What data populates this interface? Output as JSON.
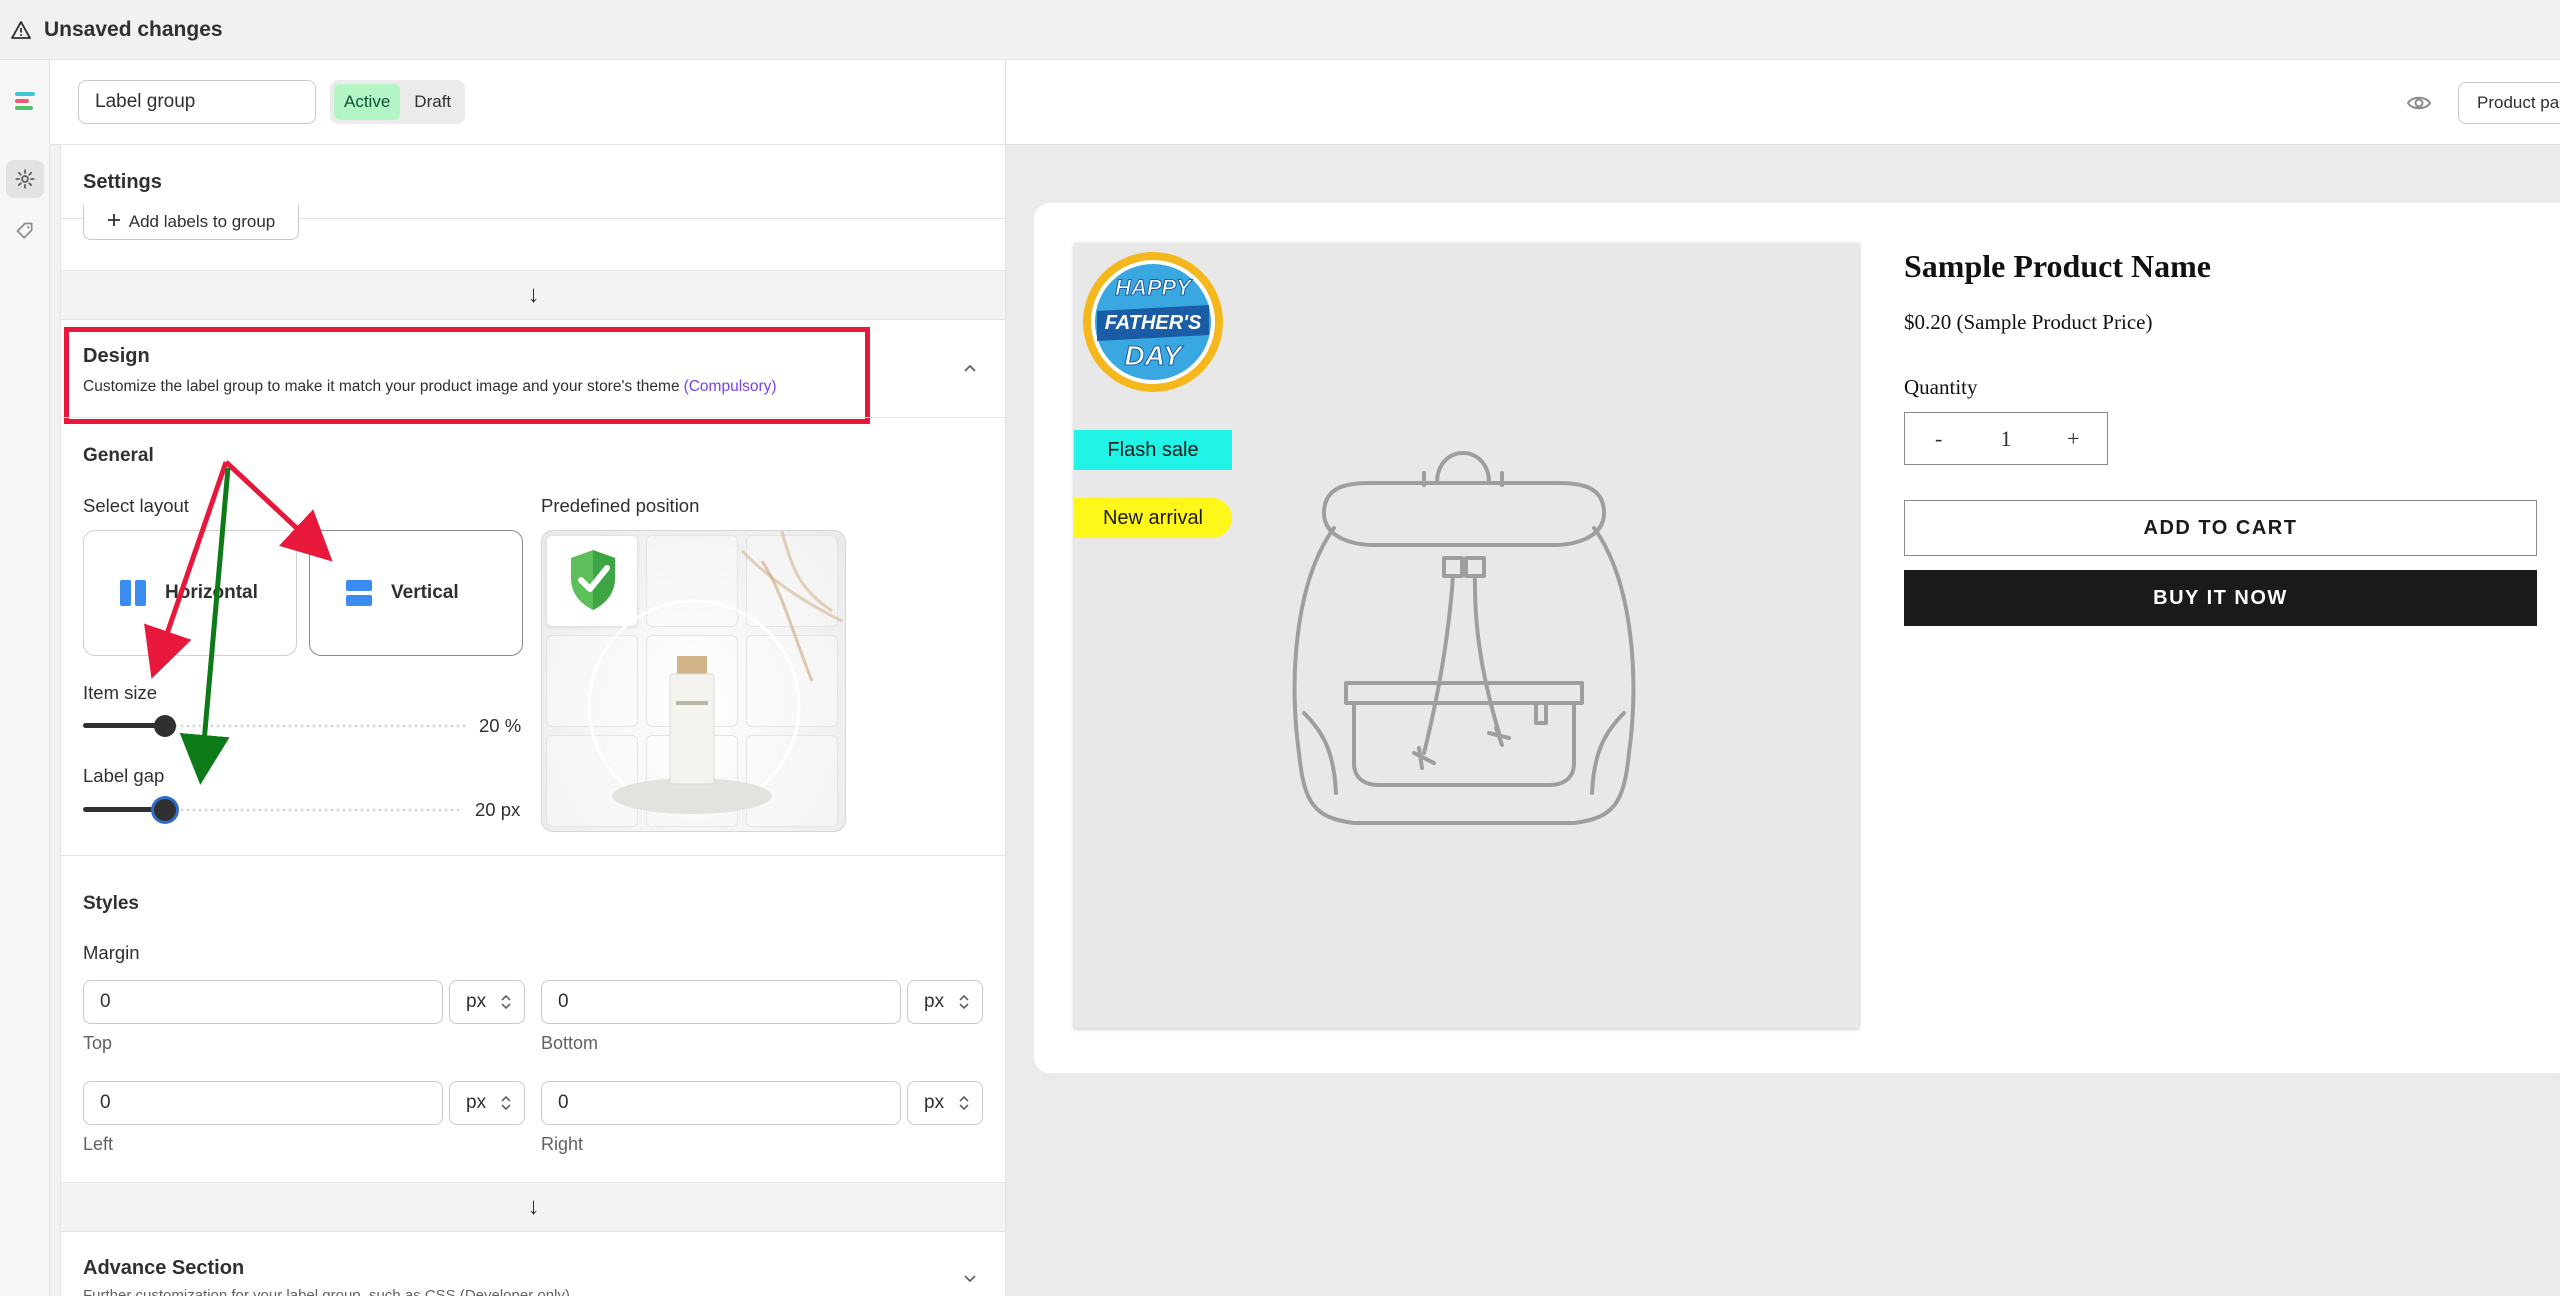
{
  "topbar": {
    "title": "Unsaved changes"
  },
  "editor": {
    "name_value": "Label group",
    "status": {
      "active": "Active",
      "draft": "Draft"
    }
  },
  "preview_header": {
    "page_button": "Product pa"
  },
  "settings": {
    "title": "Settings",
    "add_labels_button": "Add labels to group",
    "strip_arrow": "↓"
  },
  "design": {
    "title": "Design",
    "description": "Customize the label group to make it match your product image and your store's theme",
    "compulsory": "(Compulsory)",
    "general": {
      "title": "General",
      "select_layout_label": "Select layout",
      "layouts": [
        {
          "label": "Horizontal",
          "selected": false
        },
        {
          "label": "Vertical",
          "selected": true
        }
      ],
      "predefined_position_label": "Predefined position",
      "item_size": {
        "label": "Item size",
        "value_text": "20 %",
        "fraction": 0.2
      },
      "label_gap": {
        "label": "Label gap",
        "value_text": "20 px",
        "fraction": 0.2
      }
    }
  },
  "styles": {
    "title": "Styles",
    "margin_label": "Margin",
    "fields": {
      "top": {
        "value": "0",
        "unit": "px",
        "caption": "Top"
      },
      "bottom": {
        "value": "0",
        "unit": "px",
        "caption": "Bottom"
      },
      "left": {
        "value": "0",
        "unit": "px",
        "caption": "Left"
      },
      "right": {
        "value": "0",
        "unit": "px",
        "caption": "Right"
      }
    }
  },
  "advance": {
    "title": "Advance Section",
    "description": "Further customization for your label group, such as CSS (Developer only)"
  },
  "preview": {
    "badge_lines": [
      "HAPPY",
      "FATHER'S",
      "DAY"
    ],
    "tag_flash": "Flash sale",
    "tag_arrival": "New arrival",
    "product_name": "Sample Product Name",
    "product_price": "$0.20 (Sample Product Price)",
    "quantity_label": "Quantity",
    "qty_minus": "-",
    "qty_value": "1",
    "qty_plus": "+",
    "add_to_cart": "ADD TO CART",
    "buy_now": "BUY IT NOW"
  },
  "colors": {
    "highlight_box": "#e8173c",
    "annotation_red": "#e8173c",
    "annotation_green": "#0c7a17",
    "tag_flash_bg": "#20f4e6",
    "tag_arrival_bg": "#fff71a",
    "active_status_bg": "#b4f5c6"
  }
}
